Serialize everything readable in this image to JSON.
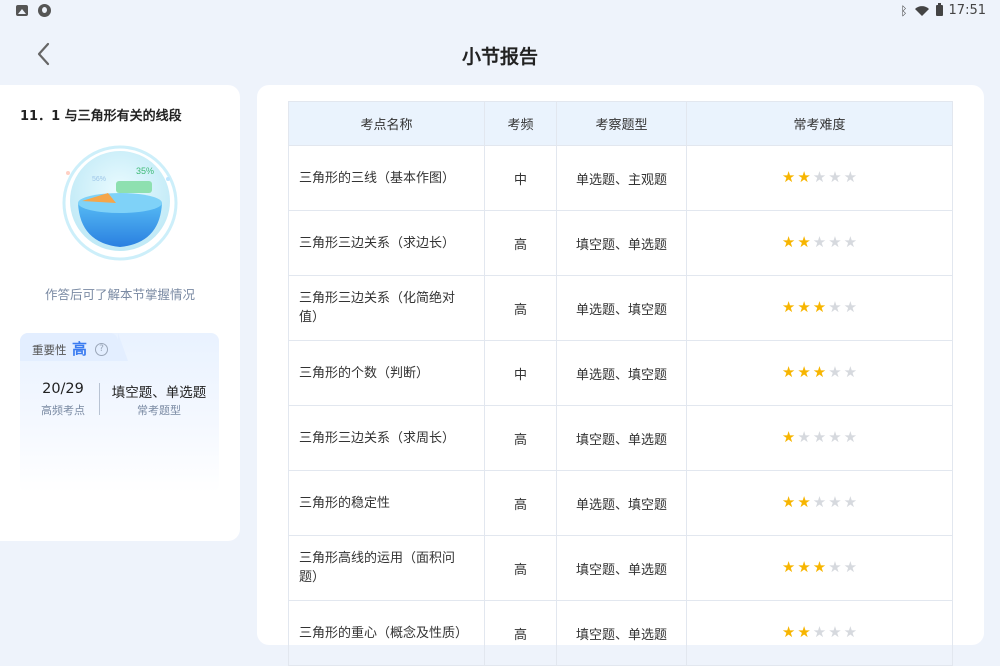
{
  "status_bar": {
    "time": "17:51"
  },
  "header": {
    "title": "小节报告"
  },
  "left_panel": {
    "section_title": "11．1 与三角形有关的线段",
    "gauge": {
      "label_a": "56%",
      "label_b": "35%"
    },
    "hint": "作答后可了解本节掌握情况",
    "importance": {
      "label": "重要性",
      "value": "高",
      "high_freq_count": "20/29",
      "high_freq_label": "高频考点",
      "common_types": "填空题、单选题",
      "common_types_label": "常考题型"
    }
  },
  "table": {
    "headers": [
      "考点名称",
      "考频",
      "考察题型",
      "常考难度"
    ],
    "rows": [
      {
        "name": "三角形的三线（基本作图）",
        "freq": "中",
        "types": "单选题、主观题",
        "difficulty": 2
      },
      {
        "name": "三角形三边关系（求边长）",
        "freq": "高",
        "types": "填空题、单选题",
        "difficulty": 2
      },
      {
        "name": "三角形三边关系（化简绝对值）",
        "freq": "高",
        "types": "单选题、填空题",
        "difficulty": 3
      },
      {
        "name": "三角形的个数（判断）",
        "freq": "中",
        "types": "单选题、填空题",
        "difficulty": 3
      },
      {
        "name": "三角形三边关系（求周长）",
        "freq": "高",
        "types": "填空题、单选题",
        "difficulty": 1
      },
      {
        "name": "三角形的稳定性",
        "freq": "高",
        "types": "单选题、填空题",
        "difficulty": 2
      },
      {
        "name": "三角形高线的运用（面积问题）",
        "freq": "高",
        "types": "填空题、单选题",
        "difficulty": 3
      },
      {
        "name": "三角形的重心（概念及性质）",
        "freq": "高",
        "types": "填空题、单选题",
        "difficulty": 2
      }
    ],
    "max_difficulty": 5
  },
  "colors": {
    "accent": "#3a7bf0",
    "star_on": "#f7b500",
    "star_off": "#d6d9de",
    "header_bg": "#eaf3fd"
  }
}
